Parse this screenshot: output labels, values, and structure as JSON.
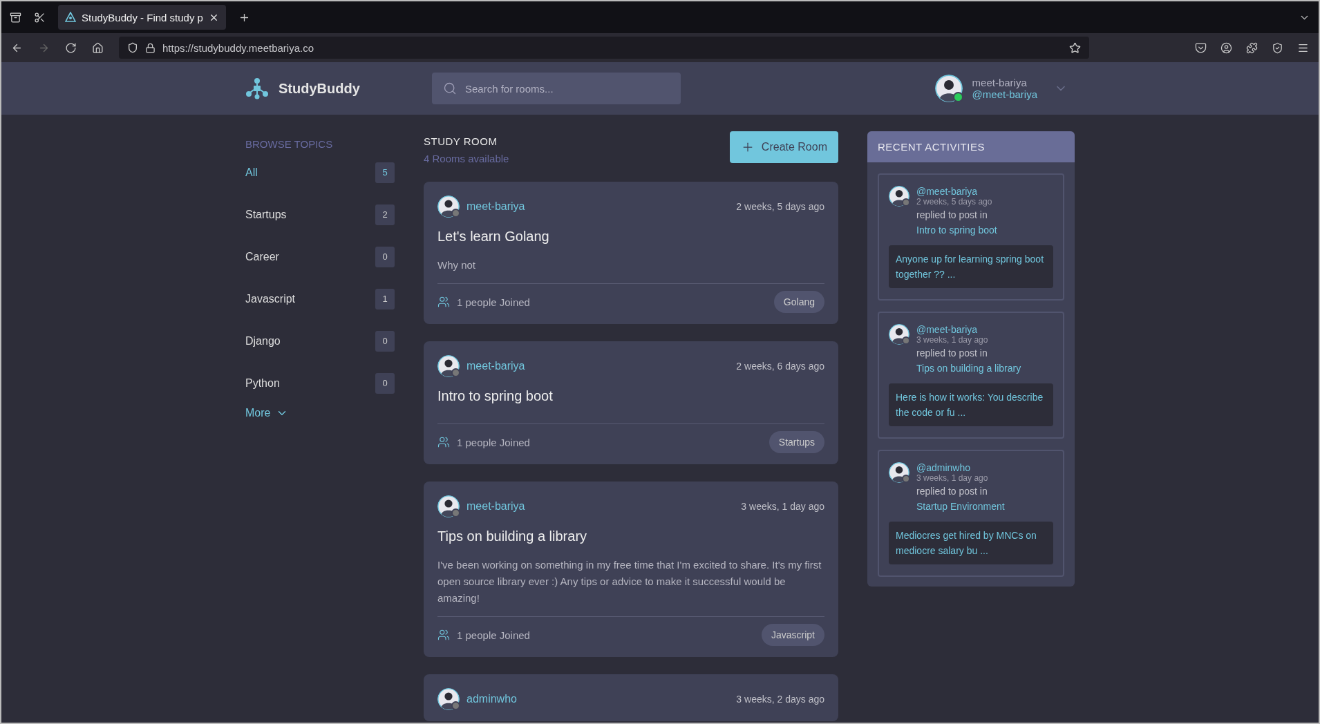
{
  "browser": {
    "tab": {
      "title": "StudyBuddy - Find study p",
      "selected": true
    },
    "url": "https://studybuddy.meetbariya.co"
  },
  "header": {
    "logo": "StudyBuddy",
    "search": {
      "placeholder": "Search for rooms..."
    },
    "user": {
      "name": "meet-bariya",
      "handle": "@meet-bariya",
      "online": true
    }
  },
  "sidebar": {
    "title": "BROWSE TOPICS",
    "topics": [
      {
        "label": "All",
        "count": "5",
        "selected": true
      },
      {
        "label": "Startups",
        "count": "2",
        "selected": false
      },
      {
        "label": "Career",
        "count": "0",
        "selected": false
      },
      {
        "label": "Javascript",
        "count": "1",
        "selected": false
      },
      {
        "label": "Django",
        "count": "0",
        "selected": false
      },
      {
        "label": "Python",
        "count": "0",
        "selected": false
      }
    ],
    "more": "More"
  },
  "feed": {
    "title": "STUDY ROOM",
    "subtitle": "4 Rooms available",
    "create_button": "Create Room",
    "rooms": [
      {
        "host": "meet-bariya",
        "online": false,
        "time": "2 weeks, 5 days ago",
        "title": "Let's learn Golang",
        "description": "Why not",
        "joined": "1 people Joined",
        "topic": "Golang"
      },
      {
        "host": "meet-bariya",
        "online": false,
        "time": "2 weeks, 6 days ago",
        "title": "Intro to spring boot",
        "joined": "1 people Joined",
        "topic": "Startups"
      },
      {
        "host": "meet-bariya",
        "online": false,
        "time": "3 weeks, 1 day ago",
        "title": "Tips on building a library",
        "description": "I've been working on something in my free time that I'm excited to share. It's my first open source library ever :) Any tips or advice to make it successful would be amazing!",
        "joined": "1 people Joined",
        "topic": "Javascript"
      },
      {
        "host": "adminwho",
        "online": false,
        "time": "3 weeks, 2 days ago"
      }
    ]
  },
  "activities": {
    "title": "RECENT ACTIVITIES",
    "items": [
      {
        "user": "@meet-bariya",
        "online": false,
        "time": "2 weeks, 5 days ago",
        "action": "replied to post in",
        "room": "Intro to spring boot",
        "message": "Anyone up for learning spring boot together ?? ..."
      },
      {
        "user": "@meet-bariya",
        "online": false,
        "time": "3 weeks, 1 day ago",
        "action": "replied to post in",
        "room": "Tips on building a library",
        "message": "Here is how it works: You describe the code or fu ..."
      },
      {
        "user": "@adminwho",
        "online": false,
        "time": "3 weeks, 1 day ago",
        "action": "replied to post in",
        "room": "Startup Environment",
        "message": "Mediocres get hired by MNCs on mediocre salary bu ..."
      }
    ]
  }
}
